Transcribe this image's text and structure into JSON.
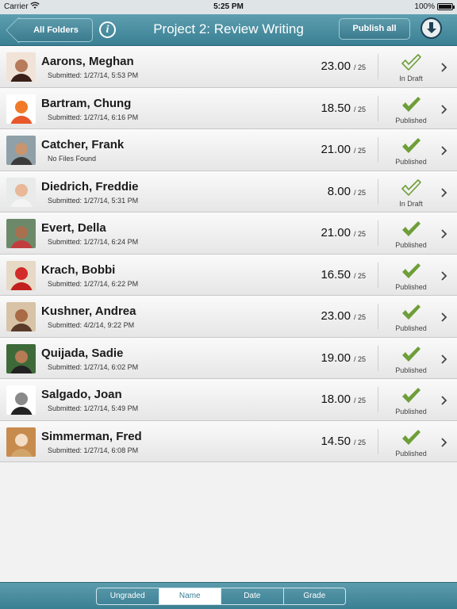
{
  "status_bar": {
    "carrier": "Carrier",
    "time": "5:25 PM",
    "battery": "100%"
  },
  "nav": {
    "back_label": "All Folders",
    "info_glyph": "i",
    "title": "Project 2: Review Writing",
    "publish_label": "Publish all",
    "download_icon": "download-icon"
  },
  "students": [
    {
      "name": "Aarons, Meghan",
      "sub": "Submitted: 1/27/14, 5:53 PM",
      "score": "23.00",
      "outof": "/ 25",
      "status": "In Draft",
      "avatar_bg": "#f1e3d8",
      "avatar_skin": "#b57b5a",
      "avatar_shirt": "#3a2018"
    },
    {
      "name": "Bartram, Chung",
      "sub": "Submitted: 1/27/14, 6:16 PM",
      "score": "18.50",
      "outof": "/ 25",
      "status": "Published",
      "avatar_bg": "#ffffff",
      "avatar_skin": "#f07a2a",
      "avatar_shirt": "#e8582a"
    },
    {
      "name": "Catcher, Frank",
      "sub": "No Files Found",
      "score": "21.00",
      "outof": "/ 25",
      "status": "Published",
      "avatar_bg": "#8fa0a8",
      "avatar_skin": "#c7956f",
      "avatar_shirt": "#3b3b3b"
    },
    {
      "name": "Diedrich, Freddie",
      "sub": "Submitted: 1/27/14, 5:31 PM",
      "score": "8.00",
      "outof": "/ 25",
      "status": "In Draft",
      "avatar_bg": "#e9eaea",
      "avatar_skin": "#e9b898",
      "avatar_shirt": "#f4f4f4"
    },
    {
      "name": "Evert, Della",
      "sub": "Submitted: 1/27/14, 6:24 PM",
      "score": "21.00",
      "outof": "/ 25",
      "status": "Published",
      "avatar_bg": "#6c8a6a",
      "avatar_skin": "#a8704e",
      "avatar_shirt": "#c23e3e"
    },
    {
      "name": "Krach, Bobbi",
      "sub": "Submitted: 1/27/14, 6:22 PM",
      "score": "16.50",
      "outof": "/ 25",
      "status": "Published",
      "avatar_bg": "#e6d9c6",
      "avatar_skin": "#d32a2a",
      "avatar_shirt": "#c21f1f"
    },
    {
      "name": "Kushner, Andrea",
      "sub": "Submitted: 4/2/14, 9:22 PM",
      "score": "23.00",
      "outof": "/ 25",
      "status": "Published",
      "avatar_bg": "#d8c3a7",
      "avatar_skin": "#a86b45",
      "avatar_shirt": "#5a3a2a"
    },
    {
      "name": "Quijada, Sadie",
      "sub": "Submitted: 1/27/14, 6:02 PM",
      "score": "19.00",
      "outof": "/ 25",
      "status": "Published",
      "avatar_bg": "#3e6a3a",
      "avatar_skin": "#b57b55",
      "avatar_shirt": "#222222"
    },
    {
      "name": "Salgado, Joan",
      "sub": "Submitted: 1/27/14, 5:49 PM",
      "score": "18.00",
      "outof": "/ 25",
      "status": "Published",
      "avatar_bg": "#ffffff",
      "avatar_skin": "#8a8a8a",
      "avatar_shirt": "#222222"
    },
    {
      "name": "Simmerman, Fred",
      "sub": "Submitted: 1/27/14, 6:08 PM",
      "score": "14.50",
      "outof": "/ 25",
      "status": "Published",
      "avatar_bg": "#c88b4e",
      "avatar_skin": "#f3ddc4",
      "avatar_shirt": "#d1a46a"
    }
  ],
  "sort_tabs": [
    {
      "label": "Ungraded",
      "active": false
    },
    {
      "label": "Name",
      "active": true
    },
    {
      "label": "Date",
      "active": false
    },
    {
      "label": "Grade",
      "active": false
    }
  ],
  "colors": {
    "check_green": "#6e9e38",
    "check_outline": "#7aa64a",
    "nav_accent": "#3a7f93"
  }
}
